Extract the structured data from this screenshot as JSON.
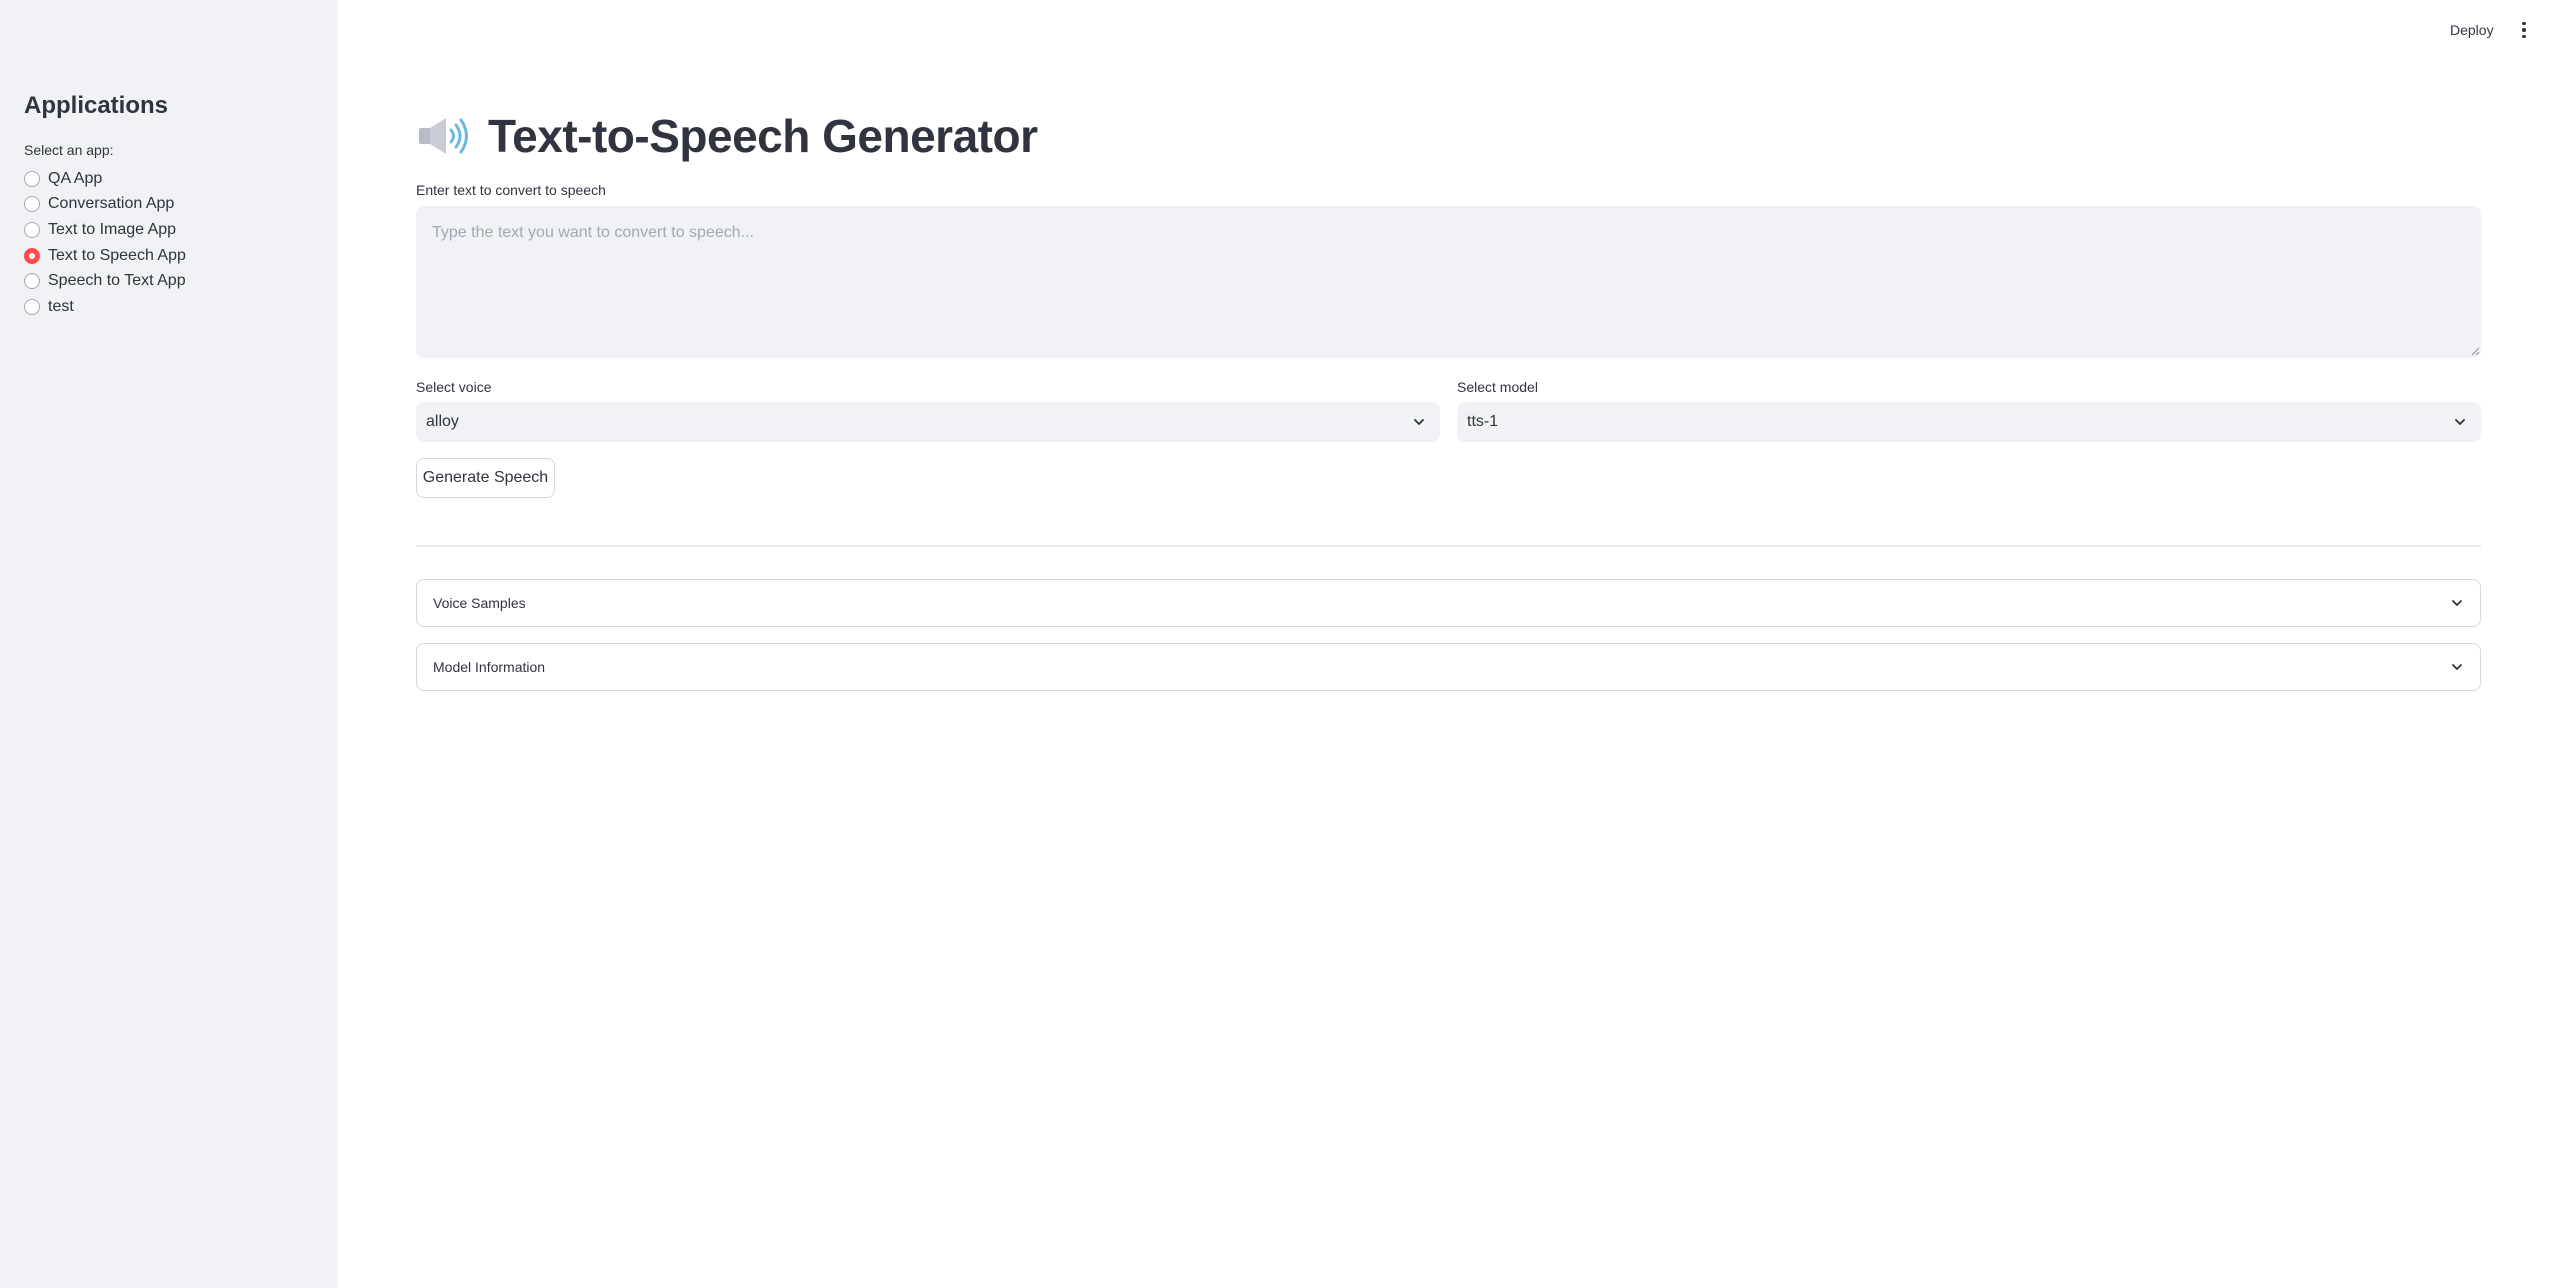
{
  "header": {
    "deploy_label": "Deploy"
  },
  "sidebar": {
    "title": "Applications",
    "radio_label": "Select an app:",
    "items": [
      {
        "label": "QA App",
        "checked": false
      },
      {
        "label": "Conversation App",
        "checked": false
      },
      {
        "label": "Text to Image App",
        "checked": false
      },
      {
        "label": "Text to Speech App",
        "checked": true
      },
      {
        "label": "Speech to Text App",
        "checked": false
      },
      {
        "label": "test",
        "checked": false
      }
    ]
  },
  "main": {
    "title": "Text-to-Speech Generator",
    "text_input": {
      "label": "Enter text to convert to speech",
      "placeholder": "Type the text you want to convert to speech...",
      "value": ""
    },
    "voice_select": {
      "label": "Select voice",
      "value": "alloy"
    },
    "model_select": {
      "label": "Select model",
      "value": "tts-1"
    },
    "generate_button": "Generate Speech",
    "expanders": [
      {
        "label": "Voice Samples"
      },
      {
        "label": "Model Information"
      }
    ]
  },
  "colors": {
    "accent": "#ff4b4b",
    "sidebar_bg": "#f0f2f6",
    "text": "#31333f"
  }
}
